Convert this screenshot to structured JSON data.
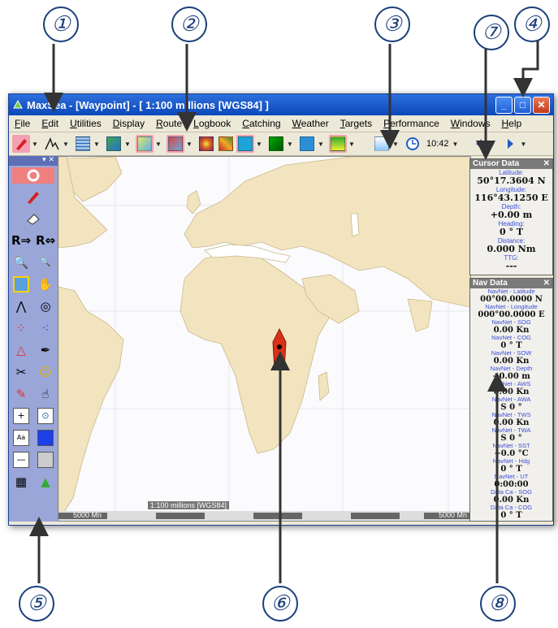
{
  "callouts": [
    "①",
    "②",
    "③",
    "④",
    "⑤",
    "⑥",
    "⑦",
    "⑧"
  ],
  "window": {
    "title": "MaxSea - [Waypoint] - [ 1:100 millions [WGS84] ]",
    "buttons": {
      "minimize": "_",
      "maximize": "□",
      "close": "✕"
    }
  },
  "menu": [
    "File",
    "Edit",
    "Utilities",
    "Display",
    "Route",
    "Logbook",
    "Catching",
    "Weather",
    "Targets",
    "Performance",
    "Windows",
    "Help"
  ],
  "toolbar": {
    "clock_time": "10:42"
  },
  "left_toolbar": {
    "header_close": "▾  ✕"
  },
  "map": {
    "scale_left": "5000 Mn",
    "scale_center": "1:100 millions [WGS84]",
    "scale_right": "5000 Mn"
  },
  "cursor_data": {
    "title": "Cursor Data",
    "close": "✕",
    "fields": [
      {
        "label": "Latitude:",
        "value": "50°17.3604 N"
      },
      {
        "label": "Longitude:",
        "value": "116°43.1250 E"
      },
      {
        "label": "Depth:",
        "value": "+0.00 m"
      },
      {
        "label": "Heading:",
        "value": "0 ° T"
      },
      {
        "label": "Distance:",
        "value": "0.000 Nm"
      },
      {
        "label": "TTG:",
        "value": "---"
      }
    ]
  },
  "nav_data": {
    "title": "Nav Data",
    "close": "✕",
    "fields": [
      {
        "label": "NavNet - Latitude",
        "value": "00°00.0000 N"
      },
      {
        "label": "NavNet - Longitude",
        "value": "000°00.0000 E"
      },
      {
        "label": "NavNet - SOG",
        "value": "0.00 Kn"
      },
      {
        "label": "NavNet - COG",
        "value": "0 ° T"
      },
      {
        "label": "NavNet - SOW",
        "value": "0.00 Kn"
      },
      {
        "label": "NavNet - Depth",
        "value": "+0.00 m"
      },
      {
        "label": "NavNet - AWS",
        "value": "0.00 Kn"
      },
      {
        "label": "NavNet - AWA",
        "value": "S 0 °"
      },
      {
        "label": "NavNet - TWS",
        "value": "0.00 Kn"
      },
      {
        "label": "NavNet - TWA",
        "value": "S 0 °"
      },
      {
        "label": "NavNet - SST",
        "value": "+0.0 °C"
      },
      {
        "label": "NavNet - Hdg",
        "value": "0 ° T"
      },
      {
        "label": "NavNet - UT",
        "value": "0:00:00"
      },
      {
        "label": "Data Ca - SOG",
        "value": "0.00 Kn"
      },
      {
        "label": "Data Ca - COG",
        "value": "0 ° T"
      }
    ]
  },
  "colors": {
    "title_bar": "#0c48b8",
    "land": "#f3e4c0",
    "vessel": "#d9301a",
    "label_blue": "#3a4fd8"
  }
}
